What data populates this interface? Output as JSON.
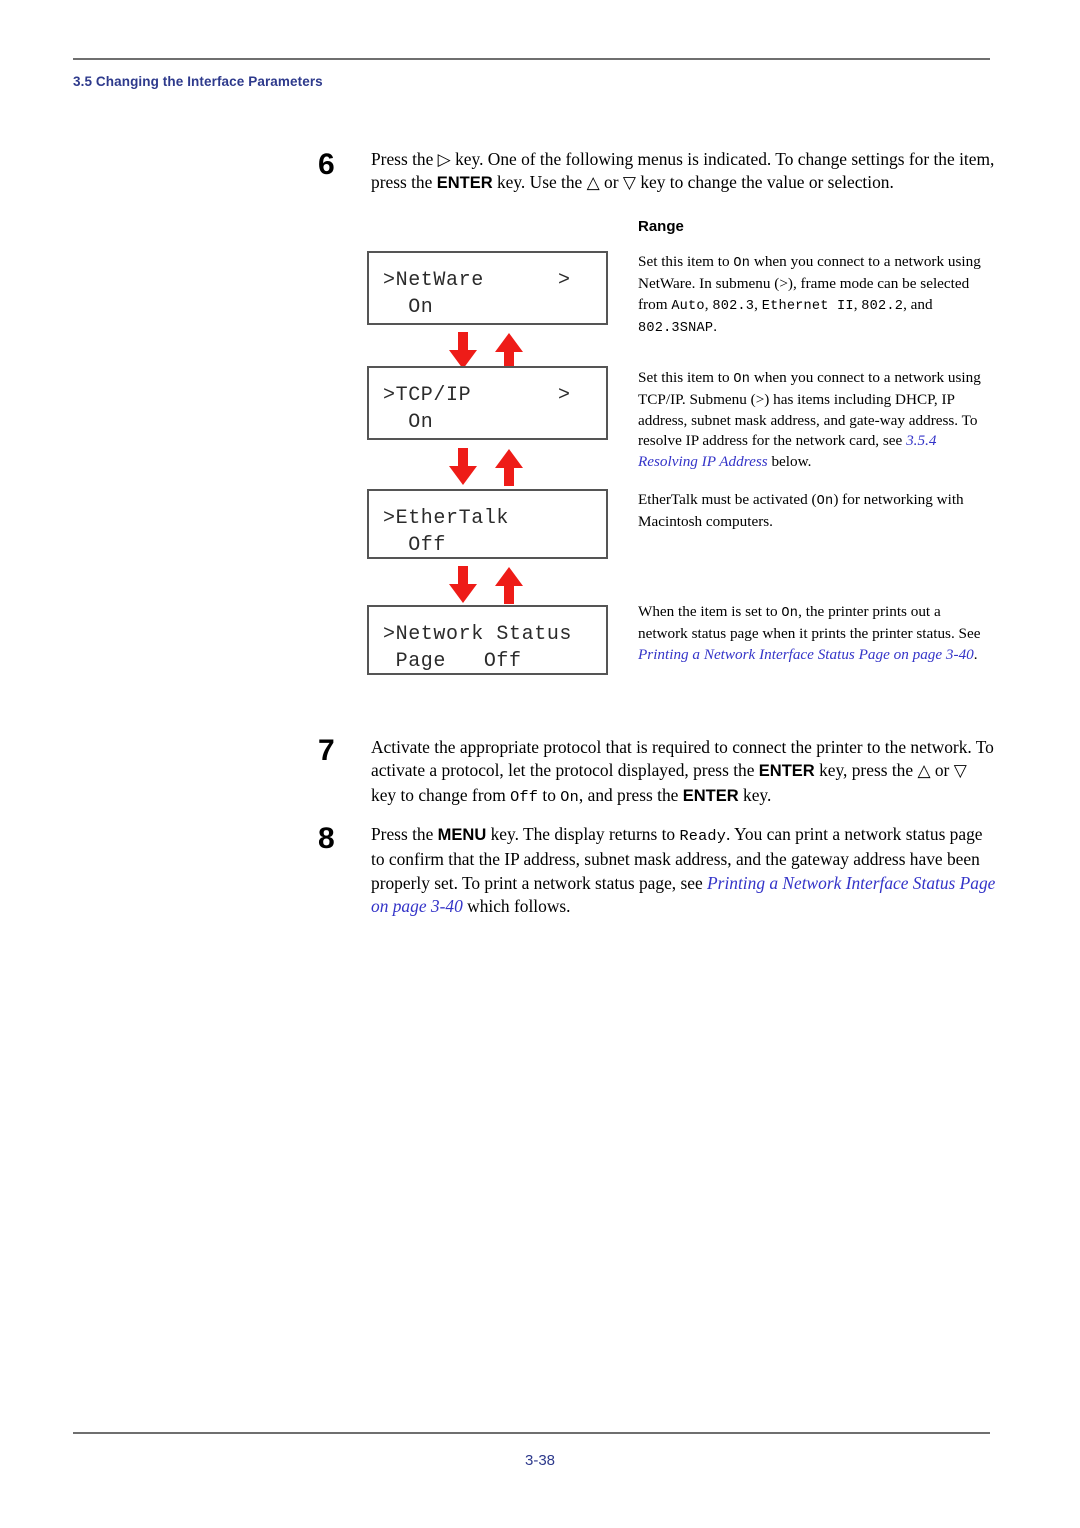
{
  "header": {
    "section_title": "3.5 Changing the Interface Parameters",
    "accent_color": "#2e3a8c"
  },
  "footer": {
    "page_number": "3-38"
  },
  "steps": [
    {
      "number": "6",
      "line1_a": "Press the ",
      "glyph_right": "▷",
      "line1_b": " key. One of the following menus is indicated. To change settings for the",
      "line2_a": "item, press the ",
      "key_enter": "ENTER",
      "line2_b": " key. Use the ",
      "glyph_up": "△",
      "line2_c": " or ",
      "glyph_down": "▽",
      "line2_d": " key to change the value or selection."
    },
    {
      "number": "7",
      "text_a": "Activate the appropriate protocol that is required to connect the printer to the network. To activate a protocol, let the protocol displayed, press the ",
      "key_enter_1": "ENTER",
      "text_b": " key, press the ",
      "glyph_up": "△",
      "text_c": " or ",
      "glyph_down": "▽",
      "text_d": " key to change from ",
      "code_off": "Off",
      "text_e": " to ",
      "code_on": "On",
      "text_f": ", and press the ",
      "key_enter_2": "ENTER",
      "text_g": " key."
    },
    {
      "number": "8",
      "text_a": "Press the ",
      "key_menu": "MENU",
      "text_b": " key. The display returns to ",
      "code_ready": "Ready",
      "text_c": ". You can print a network status page to confirm that the IP address, subnet mask address, and the gateway address have been properly set. To print a network status page, see ",
      "xref": "Printing a Network Interface Status Page on page 3-40",
      "text_d": " which follows."
    }
  ],
  "lcd_panels": [
    {
      "name": "netware",
      "line1": ">NetWare",
      "line2": "  On",
      "submenu": ">"
    },
    {
      "name": "tcpip",
      "line1": ">TCP/IP",
      "line2": "  On",
      "submenu": ">"
    },
    {
      "name": "ethertalk",
      "line1": ">EtherTalk",
      "line2": "  Off",
      "submenu": ""
    },
    {
      "name": "network-status",
      "line1": ">Network Status",
      "line2": " Page   Off",
      "submenu": ""
    }
  ],
  "arrows": {
    "down_icon": "arrow-down-icon",
    "up_icon": "arrow-up-icon",
    "color": "#ee1c18"
  },
  "range": {
    "heading": "Range",
    "items": [
      {
        "for": "netware",
        "t1": "Set this item to ",
        "c1": "On",
        "t2": " when you connect to a network using NetWare. In submenu (>), frame mode can be selected from ",
        "c2": "Auto",
        "t3": ", ",
        "c3": "802.3",
        "t4": ", ",
        "c4": "Ethernet II",
        "t5": ", ",
        "c5": "802.2",
        "t6": ", and ",
        "c6": "802.3SNAP",
        "t7": "."
      },
      {
        "for": "tcpip",
        "t1": "Set this item to ",
        "c1": "On",
        "t2": " when you connect to a network using TCP/IP. Submenu (>) has items including DHCP, IP address, subnet mask address, and gate-way address. To resolve IP address for the network card, see ",
        "xref": "3.5.4 Resolving IP Address",
        "t3": " below."
      },
      {
        "for": "ethertalk",
        "t1": "EtherTalk must be activated (",
        "c1": "On",
        "t2": ") for networking with Macintosh computers."
      },
      {
        "for": "network-status",
        "t1": "When the item is set to ",
        "c1": "On",
        "t2": ", the printer prints out a network status page when it prints the printer status. See ",
        "xref": "Printing a Network Interface Status Page on page 3-40",
        "t3": "."
      }
    ]
  }
}
